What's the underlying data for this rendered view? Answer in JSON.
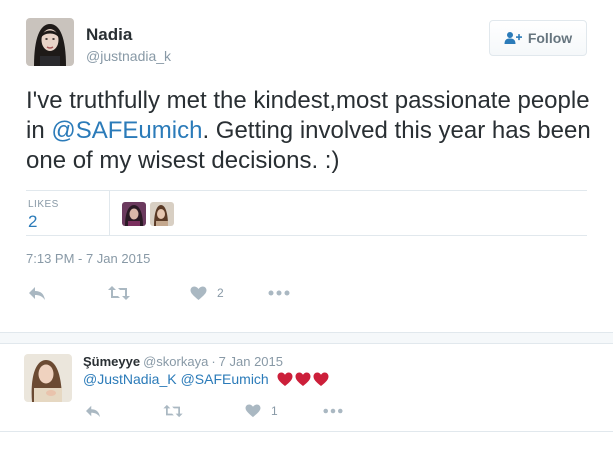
{
  "tweet": {
    "name": "Nadia",
    "handle": "@justnadia_k",
    "follow_label": "Follow",
    "text_before": "I've truthfully met the kindest,most passionate people in ",
    "mention": "@SAFEumich",
    "text_after": ". Getting involved this year has been one of my wisest decisions. :)",
    "likes_label": "LIKES",
    "likes_count": "2",
    "timestamp": "7:13 PM - 7 Jan 2015",
    "actions": {
      "reply_icon": "reply-icon",
      "retweet_icon": "retweet-icon",
      "like_icon": "heart-icon",
      "like_count": "2",
      "more_icon": "more-icon"
    }
  },
  "reply": {
    "name": "Şümeyye",
    "handle": "@skorkaya",
    "separator": "·",
    "date": "7 Jan 2015",
    "mention1": "@JustNadia_K",
    "mention2": "@SAFEumich",
    "emoji": "red-heart-icon x3",
    "actions": {
      "like_count": "1"
    }
  },
  "colors": {
    "link": "#2b7bb9",
    "muted": "#8899a6",
    "text": "#292f33",
    "heart": "#cc1f3a",
    "border": "#e1e8ed"
  }
}
